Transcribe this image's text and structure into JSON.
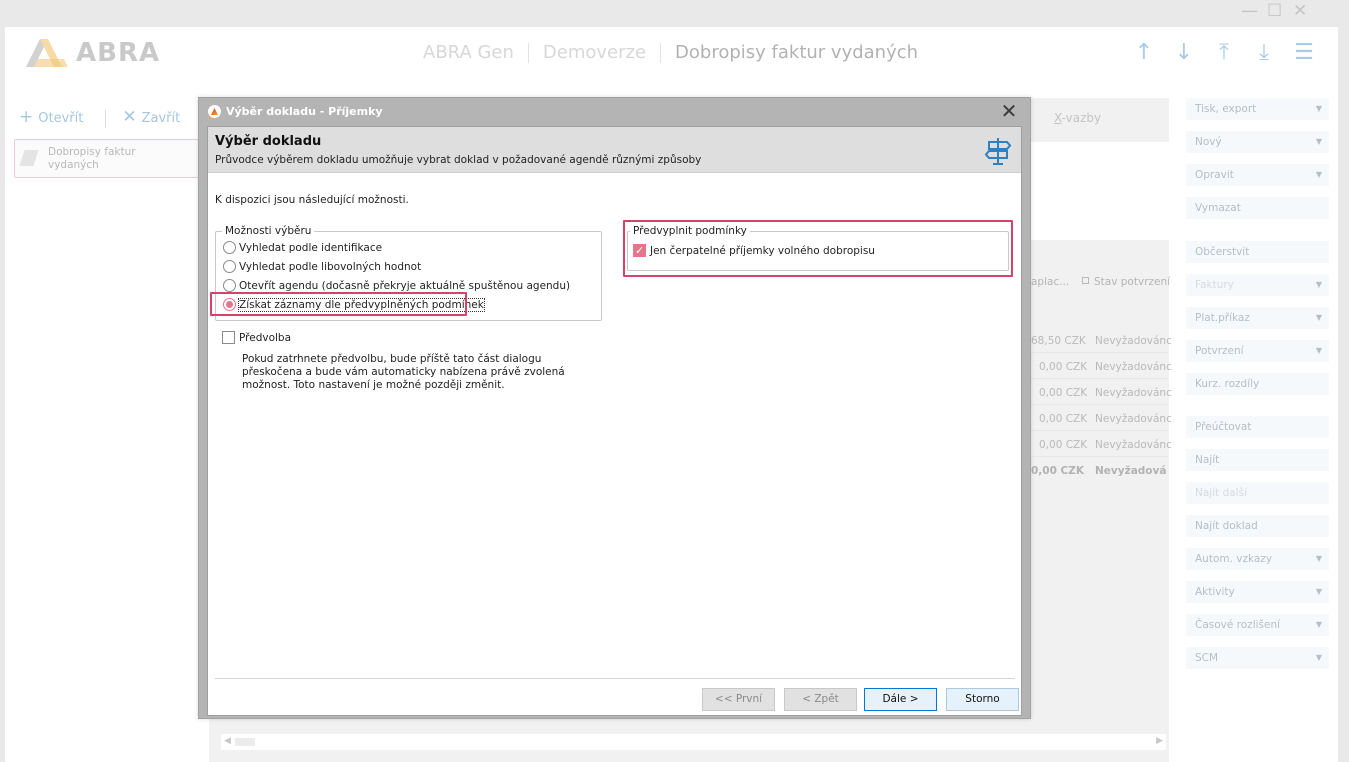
{
  "window": {
    "controls": [
      "—",
      "☐",
      "✕"
    ]
  },
  "header": {
    "logo_text": "ABRA",
    "crumbs": [
      "ABRA Gen",
      "Demoverze",
      "Dobropisy faktur vydaných"
    ],
    "icons": [
      "arrow-up-icon",
      "arrow-down-icon",
      "arrow-top-icon",
      "arrow-bottom-icon",
      "menu-icon"
    ],
    "icon_glyphs": [
      "↑",
      "↓",
      "⤒",
      "⤓",
      "☰"
    ]
  },
  "left": {
    "open_label": "Otevřít",
    "close_label": "Zavřít",
    "doc_tab_line1": "Dobropisy faktur",
    "doc_tab_line2": "vydaných"
  },
  "grid": {
    "xvazby_label": "X-vazby",
    "col_paid": "aplac...",
    "col_status": "Stav potvrzení",
    "rows": [
      {
        "paid": "68,50 CZK",
        "status": "Nevyžadovánc"
      },
      {
        "paid": "0,00 CZK",
        "status": "Nevyžadovánc"
      },
      {
        "paid": "0,00 CZK",
        "status": "Nevyžadovánc"
      },
      {
        "paid": "0,00 CZK",
        "status": "Nevyžadovánc"
      },
      {
        "paid": "0,00 CZK",
        "status": "Nevyžadovánc"
      }
    ],
    "total": {
      "paid": "0,00 CZK",
      "status": "Nevyžadová"
    }
  },
  "right_panel": {
    "buttons": [
      {
        "label": "Tisk, export",
        "dropdown": true
      },
      {
        "label": "Nový",
        "dropdown": true
      },
      {
        "label": "Opravit",
        "dropdown": true
      },
      {
        "label": "Vymazat",
        "dropdown": false
      },
      {
        "label": "Občerstvit",
        "dropdown": false
      },
      {
        "label": "Faktury",
        "dropdown": true
      },
      {
        "label": "Plat.příkaz",
        "dropdown": true
      },
      {
        "label": "Potvrzení",
        "dropdown": true
      },
      {
        "label": "Kurz. rozdíly",
        "dropdown": false
      },
      {
        "label": "Přeúčtovat",
        "dropdown": false
      },
      {
        "label": "Najít",
        "dropdown": false
      },
      {
        "label": "Najít další",
        "dropdown": false
      },
      {
        "label": "Najít doklad",
        "dropdown": false
      },
      {
        "label": "Autom. vzkazy",
        "dropdown": true
      },
      {
        "label": "Aktivity",
        "dropdown": true
      },
      {
        "label": "Časové rozlišení",
        "dropdown": true
      },
      {
        "label": "SCM",
        "dropdown": true
      }
    ]
  },
  "dialog": {
    "title": "Výběr dokladu - Příjemky",
    "close_glyph": "✕",
    "wizard_title": "Výběr dokladu",
    "wizard_subtitle": "Průvodce výběrem dokladu umožňuje vybrat doklad v požadované agendě různými způsoby",
    "intro": "K dispozici jsou následující možnosti.",
    "options_legend": "Možnosti výběru",
    "options": [
      {
        "label": "Vyhledat podle identifikace",
        "selected": false
      },
      {
        "label": "Vyhledat podle libovolných hodnot",
        "selected": false
      },
      {
        "label": "Otevřít agendu (dočasně překryje aktuálně spuštěnou agendu)",
        "selected": false
      },
      {
        "label": "Získat záznamy dle předvyplněných podmínek",
        "selected": true
      }
    ],
    "preselect_label": "Předvolba",
    "preselect_checked": false,
    "preselect_note": "Pokud zatrhnete předvolbu, bude příště tato část dialogu přeskočena a bude vám automaticky nabízena právě zvolená možnost. Toto nastavení je možné později změnit.",
    "conditions_legend": "Předvyplnit podmínky",
    "conditions_checkbox": "Jen čerpatelné příjemky volného dobropisu",
    "conditions_checked": true,
    "buttons": {
      "first": "<< První",
      "back": "< Zpět",
      "next": "Dále >",
      "cancel": "Storno"
    },
    "highlight_color": "#d6436a"
  }
}
